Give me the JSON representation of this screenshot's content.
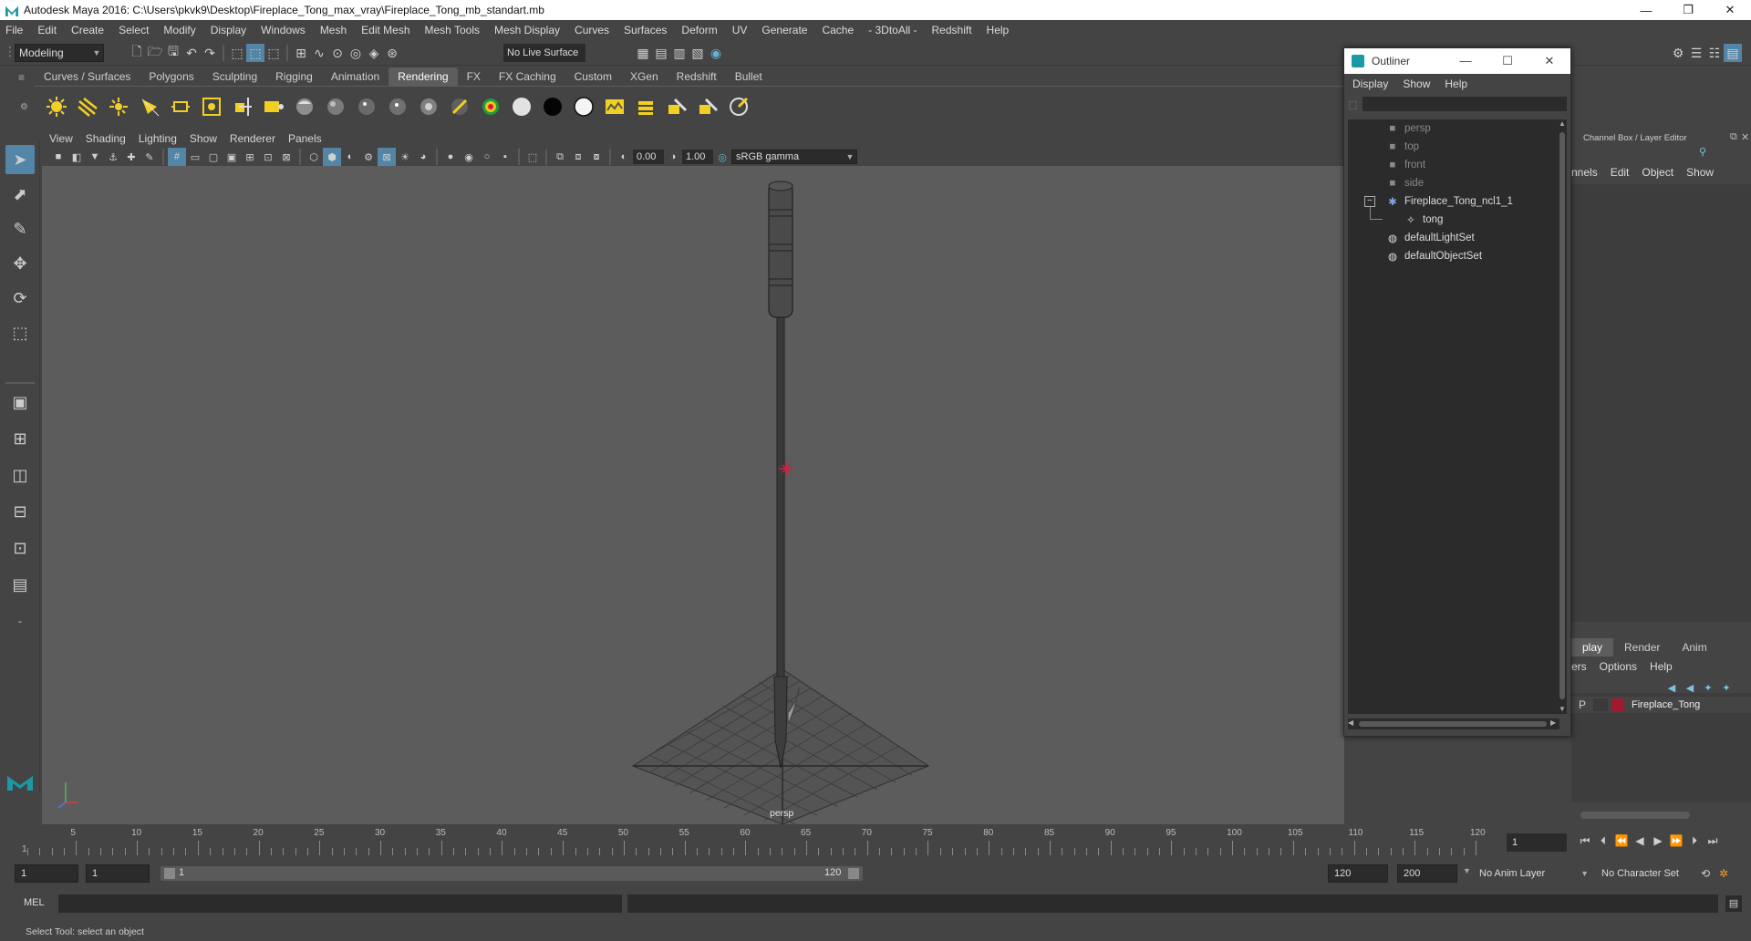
{
  "window": {
    "title": "Autodesk Maya 2016: C:\\Users\\pkvk9\\Desktop\\Fireplace_Tong_max_vray\\Fireplace_Tong_mb_standart.mb",
    "minimize": "—",
    "maximize": "❐",
    "close": "✕"
  },
  "menubar": [
    "File",
    "Edit",
    "Create",
    "Select",
    "Modify",
    "Display",
    "Windows",
    "Mesh",
    "Edit Mesh",
    "Mesh Tools",
    "Mesh Display",
    "Curves",
    "Surfaces",
    "Deform",
    "UV",
    "Generate",
    "Cache",
    "- 3DtoAll -",
    "Redshift",
    "Help"
  ],
  "statusline": {
    "mode": "Modeling",
    "live_surface": "No Live Surface"
  },
  "shelf": {
    "tabs": [
      "Curves / Surfaces",
      "Polygons",
      "Sculpting",
      "Rigging",
      "Animation",
      "Rendering",
      "FX",
      "FX Caching",
      "Custom",
      "XGen",
      "Redshift",
      "Bullet"
    ],
    "active_tab": "Rendering"
  },
  "viewport": {
    "menu": [
      "View",
      "Shading",
      "Lighting",
      "Show",
      "Renderer",
      "Panels"
    ],
    "exposure": "0.00",
    "gamma": "1.00",
    "color_space": "sRGB gamma",
    "camera_label": "persp"
  },
  "outliner": {
    "title": "Outliner",
    "menu": [
      "Display",
      "Show",
      "Help"
    ],
    "items": [
      {
        "label": "persp",
        "icon": "camera-icon"
      },
      {
        "label": "top",
        "icon": "camera-icon"
      },
      {
        "label": "front",
        "icon": "camera-icon"
      },
      {
        "label": "side",
        "icon": "camera-icon"
      },
      {
        "label": "Fireplace_Tong_ncl1_1",
        "icon": "group-icon"
      },
      {
        "label": "tong",
        "icon": "mesh-icon"
      },
      {
        "label": "defaultLightSet",
        "icon": "set-icon"
      },
      {
        "label": "defaultObjectSet",
        "icon": "set-icon"
      }
    ]
  },
  "channel_box": {
    "header": "Channel Box / Layer Editor",
    "menu": [
      "nnels",
      "Edit",
      "Object",
      "Show"
    ]
  },
  "layer_editor": {
    "tabs": [
      "play",
      "Render",
      "Anim"
    ],
    "active_tab": "play",
    "menu": [
      "ers",
      "Options",
      "Help"
    ],
    "layer": {
      "visibility": "P",
      "color": "#a01a30",
      "name": "Fireplace_Tong"
    }
  },
  "timeline": {
    "ticks": [
      "1",
      "5",
      "10",
      "15",
      "20",
      "25",
      "30",
      "35",
      "40",
      "45",
      "50",
      "55",
      "60",
      "65",
      "70",
      "75",
      "80",
      "85",
      "90",
      "95",
      "100",
      "105",
      "110",
      "115",
      "120"
    ],
    "current_frame": "1"
  },
  "range": {
    "start": "1",
    "playback_start": "1",
    "range_start_label": "1",
    "range_end_label": "120",
    "playback_end": "120",
    "end": "200",
    "anim_layer": "No Anim Layer",
    "character_set": "No Character Set"
  },
  "command": {
    "label": "MEL"
  },
  "helpline": "Select Tool: select an object"
}
